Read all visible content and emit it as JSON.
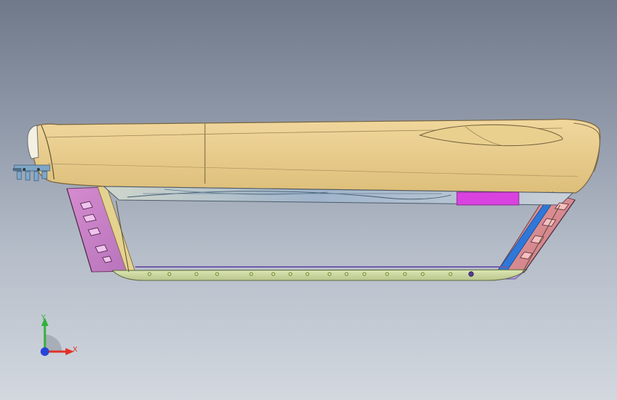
{
  "viewport": {
    "background_top": "#6f7989",
    "background_bottom": "#d3d8df"
  },
  "model": {
    "upper_body_color": "#e8cf8f",
    "side_left_color": "#d58bcf",
    "side_right_color": "#de8b8d",
    "bottom_rail_color": "#c8d6a0",
    "accent_blue_color": "#2f78d8",
    "accent_magenta_color": "#d942df"
  },
  "triad": {
    "x_label": "X",
    "y_label": "Y",
    "x_color": "#e23127",
    "y_color": "#2fb235",
    "z_color": "#2844d8",
    "triad_icon": "coordinate-triad-icon"
  }
}
